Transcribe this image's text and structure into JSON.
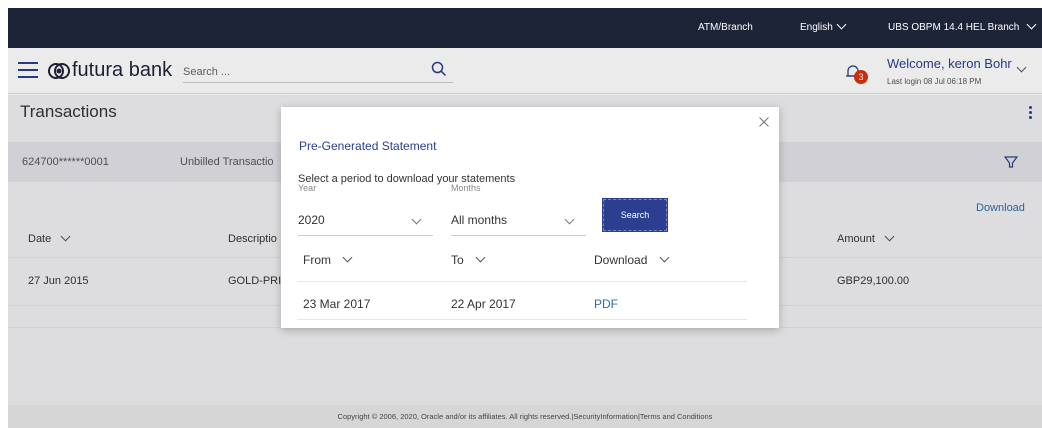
{
  "topbar": {
    "atm_branch": "ATM/Branch",
    "language": "English",
    "branch": "UBS OBPM 14.4 HEL Branch"
  },
  "header": {
    "logo_text": "futura bank",
    "search_placeholder": "Search ...",
    "notification_count": "3",
    "welcome": "Welcome, keron Bohr",
    "last_login": "Last login 08 Jul 06:18 PM"
  },
  "page": {
    "title": "Transactions",
    "account_number": "624700******0001",
    "account_type": "Unbilled Transactio",
    "download_label": "Download",
    "columns": [
      "Date",
      "Descriptio",
      "Amount"
    ],
    "row": {
      "date": "27 Jun 2015",
      "description": "GOLD-PRI",
      "amount": "GBP29,100.00"
    }
  },
  "modal": {
    "title": "Pre-Generated Statement",
    "subtitle": "Select a period to download your statements",
    "year_label": "Year",
    "year_value": "2020",
    "months_label": "Months",
    "months_value": "All months",
    "search_label": "Search",
    "columns": [
      "From",
      "To",
      "Download"
    ],
    "row": {
      "from": "23 Mar 2017",
      "to": "22 Apr 2017",
      "download": "PDF"
    }
  },
  "footer": {
    "text": "Copyright © 2006, 2020, Oracle and/or its affiliates. All rights reserved.|SecurityInformation|Terms and Conditions"
  },
  "colors": {
    "primary": "#2b3e8f",
    "topbar": "#1e2438",
    "badge": "#d9310e",
    "link": "#2b6cb0"
  }
}
